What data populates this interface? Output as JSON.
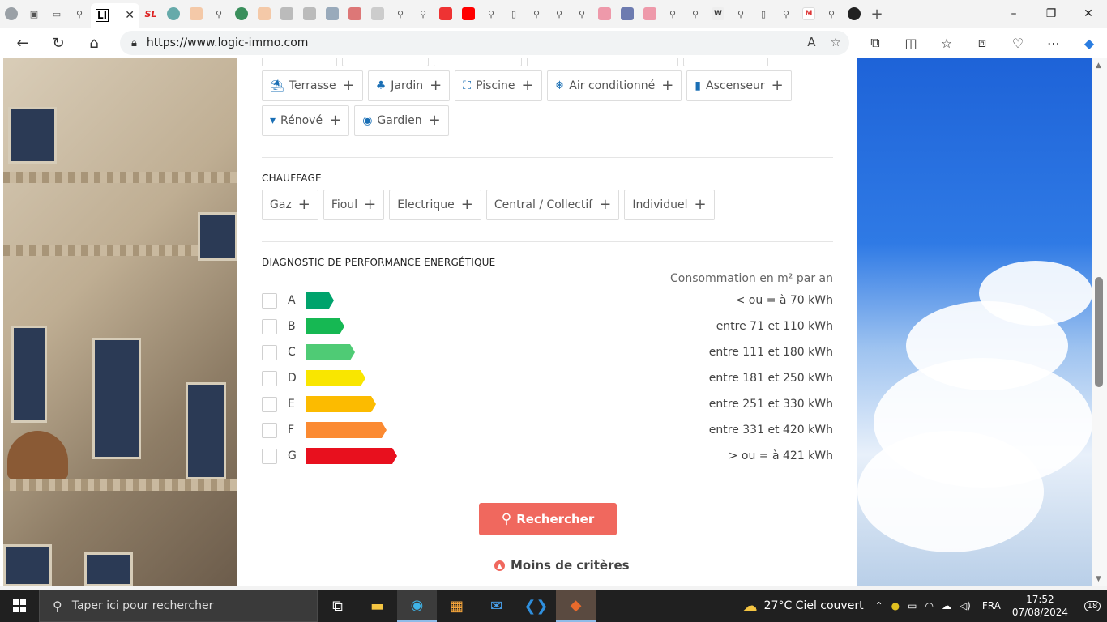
{
  "browser": {
    "active_tab_favicon": "LI",
    "url": "https://www.logic-immo.com",
    "window_controls": [
      "–",
      "❐",
      "✕"
    ]
  },
  "amenities_row1": [
    {
      "icon": "terrace-icon",
      "glyph": "⛱",
      "label": "Terrasse"
    },
    {
      "icon": "garden-tree-icon",
      "glyph": "♣",
      "label": "Jardin"
    },
    {
      "icon": "pool-icon",
      "glyph": "⛶",
      "label": "Piscine"
    },
    {
      "icon": "snowflake-icon",
      "glyph": "❄",
      "label": "Air conditionné"
    },
    {
      "icon": "elevator-icon",
      "glyph": "▮",
      "label": "Ascenseur"
    }
  ],
  "amenities_row2": [
    {
      "icon": "paint-roller-icon",
      "glyph": "▾",
      "label": "Rénové"
    },
    {
      "icon": "eye-icon",
      "glyph": "◉",
      "label": "Gardien"
    }
  ],
  "heating": {
    "title": "CHAUFFAGE",
    "options": [
      "Gaz",
      "Fioul",
      "Electrique",
      "Central / Collectif",
      "Individuel"
    ]
  },
  "dpe": {
    "title": "DIAGNOSTIC DE PERFORMANCE ENERGÉTIQUE",
    "unit_label": "Consommation en m² par an",
    "classes": [
      {
        "letter": "A",
        "range": "< ou = à 70 kWh",
        "color": "#00a36c",
        "rank": 1
      },
      {
        "letter": "B",
        "range": "entre 71 et 110 kWh",
        "color": "#16b853",
        "rank": 2
      },
      {
        "letter": "C",
        "range": "entre 111 et 180 kWh",
        "color": "#4fcb75",
        "rank": 3
      },
      {
        "letter": "D",
        "range": "entre 181 et 250 kWh",
        "color": "#f9e600",
        "rank": 4
      },
      {
        "letter": "E",
        "range": "entre 251 et 330 kWh",
        "color": "#fcbb00",
        "rank": 5
      },
      {
        "letter": "F",
        "range": "entre 331 et 420 kWh",
        "color": "#fb8a32",
        "rank": 6
      },
      {
        "letter": "G",
        "range": "> ou = à 421 kWh",
        "color": "#e8101e",
        "rank": 7
      }
    ]
  },
  "actions": {
    "search_label": "Rechercher",
    "less_criteria_label": "Moins de critères"
  },
  "taskbar": {
    "search_placeholder": "Taper ici pour rechercher",
    "weather": "27°C  Ciel couvert",
    "language": "FRA",
    "time": "17:52",
    "date": "07/08/2024",
    "notifications": "18"
  },
  "colors": {
    "accent": "#f0685e",
    "icon_blue": "#1a6fb5"
  }
}
